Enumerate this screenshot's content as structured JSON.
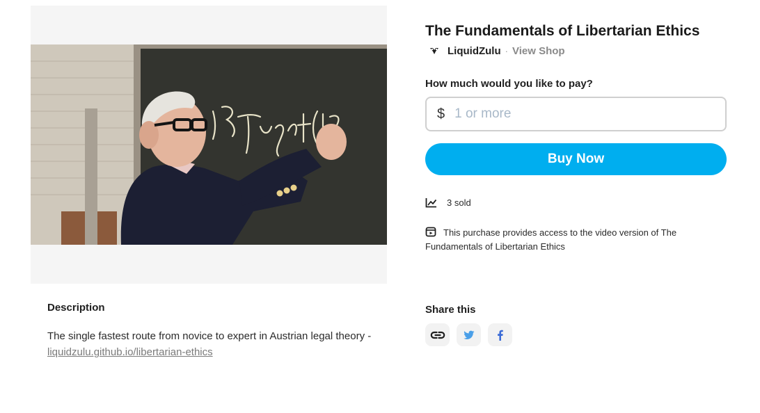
{
  "product": {
    "title": "The Fundamentals of Libertarian Ethics",
    "image_alt": "Man writing on a chalkboard"
  },
  "seller": {
    "name": "LiquidZulu",
    "separator": "·",
    "view_shop_label": "View Shop",
    "logo_icon": "seller-logo-icon"
  },
  "purchase": {
    "price_label": "How much would you like to pay?",
    "currency_symbol": "$",
    "price_placeholder": "1 or more",
    "buy_label": "Buy Now",
    "accent_color": "#00aeef"
  },
  "stats": {
    "sold_text": "3 sold",
    "sold_icon": "chart-line-icon"
  },
  "access": {
    "text": "This purchase provides access to the video version of The Fundamentals of Libertarian Ethics",
    "icon": "video-box-icon"
  },
  "description": {
    "heading": "Description",
    "text": "The single fastest route from novice to expert in Austrian legal theory - ",
    "link_text": "liquidzulu.github.io/libertarian-ethics"
  },
  "share": {
    "heading": "Share this",
    "buttons": [
      {
        "icon": "link-icon",
        "color": "#1f1f1f"
      },
      {
        "icon": "twitter-icon",
        "color": "#4a9fe8"
      },
      {
        "icon": "facebook-icon",
        "color": "#3b6bd6"
      }
    ]
  }
}
